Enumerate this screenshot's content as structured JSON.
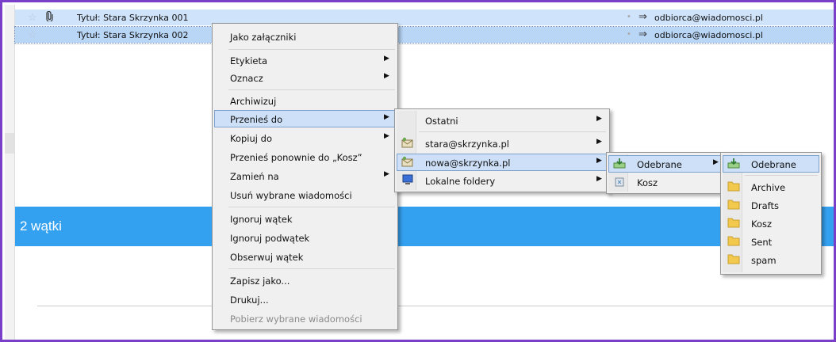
{
  "messages": [
    {
      "subject": "Tytuł: Stara Skrzynka 001",
      "recipient": "odbiorca@wiadomosci.pl"
    },
    {
      "subject": "Tytuł: Stara Skrzynka 002",
      "recipient": "odbiorca@wiadomosci.pl"
    }
  ],
  "thread_count_label": "2 wątki",
  "context_menu": {
    "as_attachments": "Jako załączniki",
    "label": "Etykieta",
    "mark": "Oznacz",
    "archive": "Archiwizuj",
    "move_to": "Przenieś do",
    "copy_to": "Kopiuj do",
    "move_again": "Przenieś ponownie do „Kosz”",
    "convert_to": "Zamień na",
    "delete_selected": "Usuń wybrane wiadomości",
    "ignore_thread": "Ignoruj wątek",
    "ignore_subthread": "Ignoruj podwątek",
    "watch_thread": "Obserwuj wątek",
    "save_as": "Zapisz jako...",
    "print": "Drukuj...",
    "download_selected": "Pobierz wybrane wiadomości"
  },
  "move_submenu": {
    "recent": "Ostatni",
    "accounts": [
      "stara@skrzynka.pl",
      "nowa@skrzynka.pl",
      "Lokalne foldery"
    ]
  },
  "account_submenu": {
    "items": [
      "Odebrane",
      "Kosz"
    ]
  },
  "inbox_submenu": {
    "header": "Odebrane",
    "folders": [
      "Archive",
      "Drafts",
      "Kosz",
      "Sent",
      "spam"
    ]
  },
  "colors": {
    "accent_bar": "#34a0f0",
    "window_border": "#7a3fc8",
    "selection": "#cde0f7",
    "folder": "#f2c94c"
  }
}
